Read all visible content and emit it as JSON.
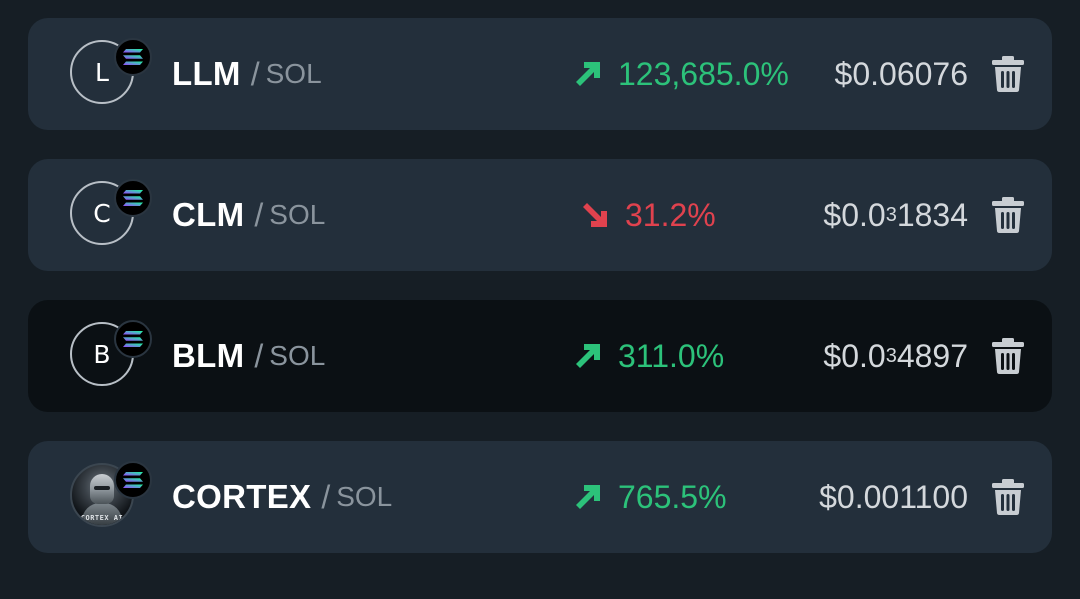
{
  "watchlist": [
    {
      "avatar_letter": "L",
      "avatar_type": "letter",
      "symbol": "LLM",
      "separator": "/",
      "quote": "SOL",
      "change": "123,685.0%",
      "direction": "up",
      "price_prefix": "$0.06076",
      "price_zeros": "",
      "price_digits": "",
      "selected": false,
      "delete_icon": "trash-icon"
    },
    {
      "avatar_letter": "C",
      "avatar_type": "letter",
      "symbol": "CLM",
      "separator": "/",
      "quote": "SOL",
      "change": "31.2%",
      "direction": "down",
      "price_prefix": "$0.0",
      "price_zeros": "3",
      "price_digits": "1834",
      "selected": false,
      "delete_icon": "trash-icon"
    },
    {
      "avatar_letter": "B",
      "avatar_type": "letter",
      "symbol": "BLM",
      "separator": "/",
      "quote": "SOL",
      "change": "311.0%",
      "direction": "up",
      "price_prefix": "$0.0",
      "price_zeros": "3",
      "price_digits": "4897",
      "selected": true,
      "delete_icon": "trash-icon"
    },
    {
      "avatar_letter": "",
      "avatar_type": "image",
      "avatar_caption": "CORTEX AI",
      "symbol": "CORTEX",
      "separator": "/",
      "quote": "SOL",
      "change": "765.5%",
      "direction": "up",
      "price_prefix": "$0.001100",
      "price_zeros": "",
      "price_digits": "",
      "selected": false,
      "delete_icon": "trash-icon"
    }
  ],
  "colors": {
    "background": "#161e25",
    "row": "#232f3b",
    "row_selected": "#0b1014",
    "up": "#2cc27a",
    "down": "#e0424e",
    "price": "#d4d8dc",
    "muted": "#8a949d"
  },
  "icons": {
    "chain_badge": "solana-icon",
    "up": "arrow-up-right-icon",
    "down": "arrow-down-right-icon",
    "delete": "trash-icon"
  }
}
